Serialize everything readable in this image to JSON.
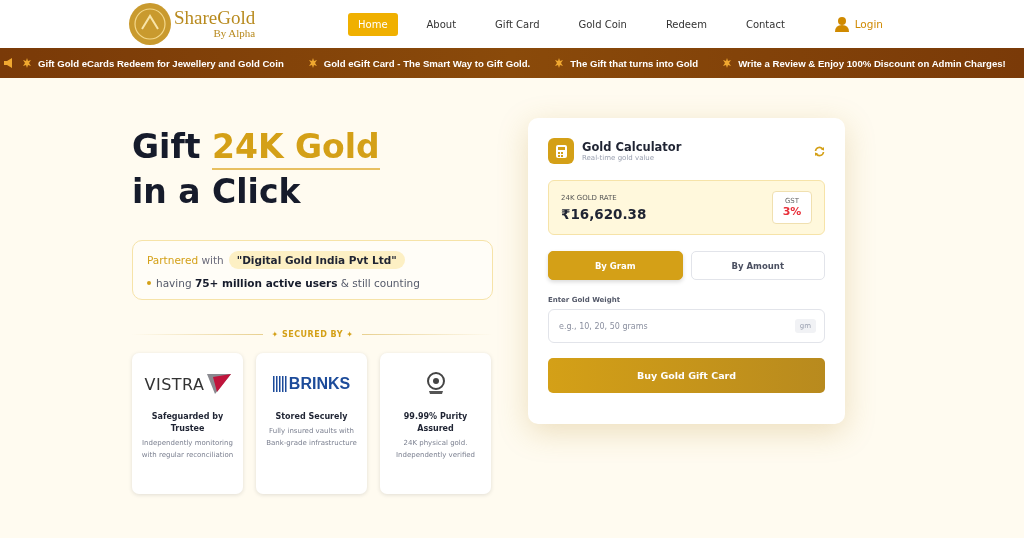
{
  "header": {
    "logo": {
      "name": "ShareGold",
      "tagline": "By Alpha"
    },
    "nav": [
      {
        "label": "Home",
        "selected": true
      },
      {
        "label": "About",
        "selected": false
      },
      {
        "label": "Gift Card",
        "selected": false
      },
      {
        "label": "Gold Coin",
        "selected": false
      },
      {
        "label": "Redeem",
        "selected": false
      },
      {
        "label": "Contact",
        "selected": false
      }
    ],
    "login": "Login"
  },
  "ticker": [
    "Gift Gold eCards Redeem for Jewellery and Gold Coin",
    "Gold eGift Card - The Smart Way to Gift Gold.",
    "The Gift that turns into Gold",
    "Write a Review & Enjoy 100% Discount on Admin Charges!"
  ],
  "hero": {
    "title_prefix": "Gift",
    "title_highlight": "24K Gold",
    "title_line2": "in a Click",
    "partner_label": "Partnered",
    "partner_with": "with",
    "partner_name": "\"Digital Gold India Pvt Ltd\"",
    "users_text": "having **75+ million active users** & still counting",
    "secured_by": "✦ SECURED BY ✦",
    "cards": [
      {
        "kind": "vistra",
        "logo_text": "VISTRA",
        "title": "Safeguarded by Trustee",
        "text": "Independently monitoring with regular reconciliation"
      },
      {
        "kind": "brinks",
        "logo_text": "BRINKS",
        "title": "Stored Securely",
        "text": "Fully insured vaults with Bank-grade infrastructure"
      },
      {
        "kind": "emblem",
        "title": "99.99% Purity Assured",
        "text": "24K physical gold. Independently verified"
      }
    ]
  },
  "calculator": {
    "title": "Gold Calculator",
    "subtitle": "Real-time gold value",
    "rate_label": "24K GOLD RATE",
    "rate": "₹16,620.38",
    "gst_label": "GST",
    "gst": "3%",
    "modes": [
      {
        "label": "By Gram",
        "selected": true
      },
      {
        "label": "By Amount",
        "selected": false
      }
    ],
    "field_label": "Enter Gold Weight",
    "placeholder": "e.g., 10, 20, 50 grams",
    "unit": "gm",
    "buy": "Buy Gold Gift Card"
  }
}
